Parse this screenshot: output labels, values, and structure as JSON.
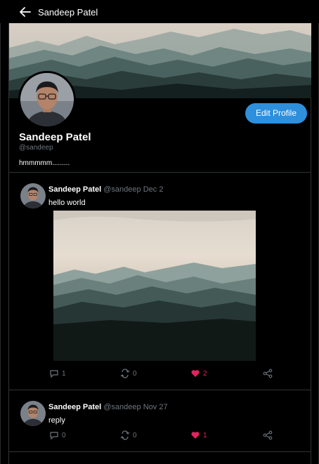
{
  "header": {
    "title": "Sandeep Patel"
  },
  "profile": {
    "name": "Sandeep Patel",
    "handle": "@sandeep",
    "bio": "hmmmmm.........",
    "edit_button": "Edit Profile"
  },
  "tweets": [
    {
      "name": "Sandeep Patel",
      "handle": "@sandeep",
      "date": "Dec 2",
      "text": "hello world",
      "replies": "1",
      "retweets": "0",
      "likes": "2"
    },
    {
      "name": "Sandeep Patel",
      "handle": "@sandeep",
      "date": "Nov 27",
      "text": "reply",
      "replies": "0",
      "retweets": "0",
      "likes": "1"
    }
  ],
  "colors": {
    "accent": "#2e8fdc",
    "like": "#e0245e",
    "muted": "#6e767d",
    "border": "#2f3336"
  }
}
